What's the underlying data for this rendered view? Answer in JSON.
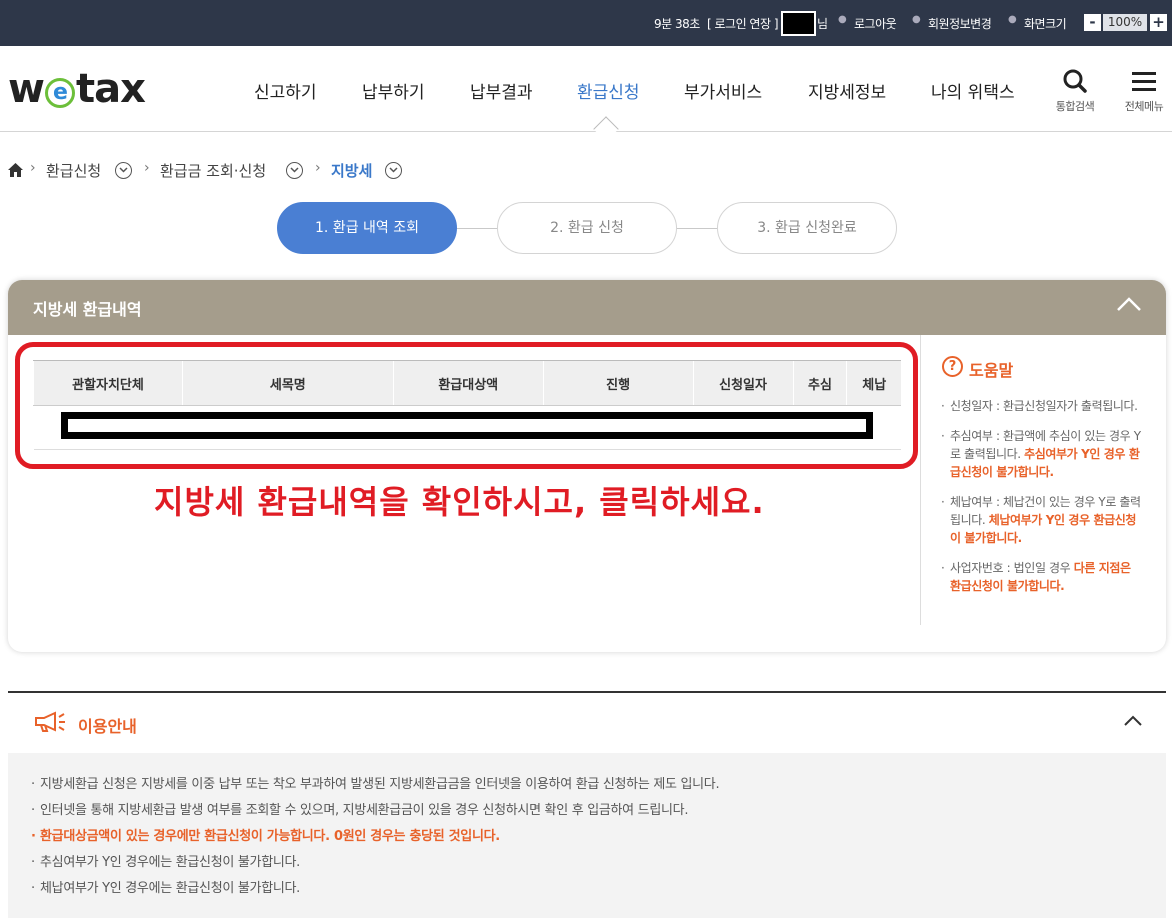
{
  "topbar": {
    "timer": "9분 38초",
    "extend_login": "[ 로그인 연장 ]",
    "user_suffix": "님",
    "logout": "로그아웃",
    "edit_profile": "회원정보변경",
    "screen_size": "화면크기",
    "zoom_minus": "-",
    "zoom_value": "100%",
    "zoom_plus": "+"
  },
  "header": {
    "logo_w": "w",
    "logo_e": "e",
    "logo_tax": "tax",
    "nav": [
      "신고하기",
      "납부하기",
      "납부결과",
      "환급신청",
      "부가서비스",
      "지방세정보",
      "나의 위택스"
    ],
    "active_nav": "환급신청",
    "search_label": "통합검색",
    "menu_label": "전체메뉴"
  },
  "breadcrumb": {
    "items": [
      "환급신청",
      "환급금 조회·신청",
      "지방세"
    ]
  },
  "steps": [
    "1. 환급 내역 조회",
    "2. 환급 신청",
    "3. 환급 신청완료"
  ],
  "panel": {
    "title": "지방세 환급내역",
    "columns": [
      "관할자치단체",
      "세목명",
      "환급대상액",
      "진행",
      "신청일자",
      "추심",
      "체납"
    ],
    "instruction": "지방세 환급내역을 확인하시고, 클릭하세요."
  },
  "help": {
    "title": "도움말",
    "item1": "신청일자 : 환급신청일자가 출력됩니다.",
    "item2_a": "추심여부 : 환급액에 추심이 있는 경우 Y로 출력됩니다. ",
    "item2_b": "추심여부가 Y인 경우 환급신청이 불가합니다.",
    "item3_a": "체납여부 : 체납건이 있는 경우 Y로 출력됩니다. ",
    "item3_b": "체납여부가 Y인 경우 환급신청이 불가합니다.",
    "item4_a": "사업자번호 : 법인일 경우 ",
    "item4_b": "다른 지점은 환급신청이 불가합니다."
  },
  "guide": {
    "title": "이용안내",
    "items": [
      "지방세환급 신청은 지방세를 이중 납부 또는 착오 부과하여 발생된 지방세환급금을 인터넷을 이용하여 환급 신청하는 제도 입니다.",
      "인터넷을 통해 지방세환급 발생 여부를 조회할 수 있으며, 지방세환급금이 있을 경우 신청하시면 확인 후 입금하여 드립니다.",
      "환급대상금액이 있는 경우에만 환급신청이 가능합니다. 0원인 경우는 충당된 것입니다.",
      "추심여부가 Y인 경우에는 환급신청이 불가합니다.",
      "체납여부가 Y인 경우에는 환급신청이 불가합니다."
    ]
  },
  "colors": {
    "topbar": "#2e3749",
    "accent_blue": "#4a7fd3",
    "panel_head": "#a59d8c",
    "highlight_red": "#e01c24",
    "help_orange": "#e8622a"
  }
}
